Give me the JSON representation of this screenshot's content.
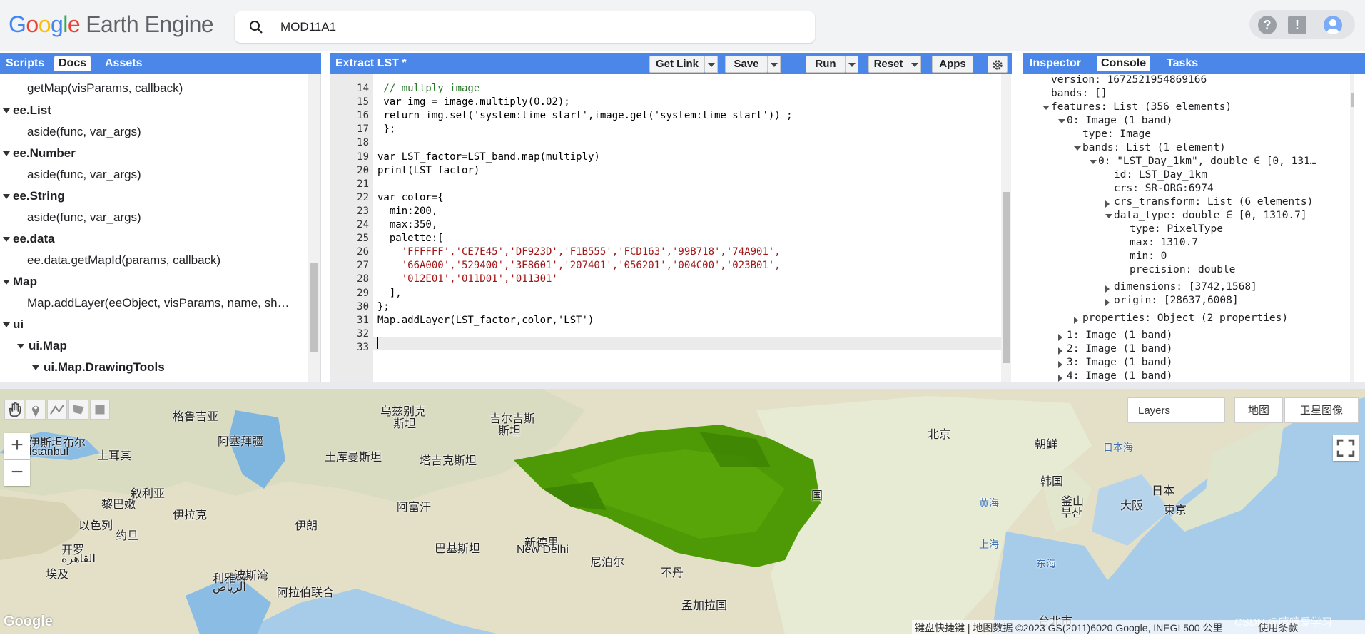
{
  "topbar": {
    "logo_google": [
      "G",
      "o",
      "o",
      "g",
      "l",
      "e"
    ],
    "logo_product": "Earth Engine",
    "search_value": "MOD11A1",
    "help_icon": "help-icon",
    "feedback_icon": "feedback-icon",
    "avatar_icon": "account-avatar-icon"
  },
  "left_panel": {
    "tabs": [
      "Scripts",
      "Docs",
      "Assets"
    ],
    "active_tab": "Docs",
    "items": [
      {
        "text": "getMap(visParams, callback)",
        "bold": false,
        "indent": 1
      },
      {
        "text": "ee.List",
        "bold": true,
        "indent": 0
      },
      {
        "text": "aside(func, var_args)",
        "bold": false,
        "indent": 1
      },
      {
        "text": "ee.Number",
        "bold": true,
        "indent": 0
      },
      {
        "text": "aside(func, var_args)",
        "bold": false,
        "indent": 1
      },
      {
        "text": "ee.String",
        "bold": true,
        "indent": 0
      },
      {
        "text": "aside(func, var_args)",
        "bold": false,
        "indent": 1
      },
      {
        "text": "ee.data",
        "bold": true,
        "indent": 0
      },
      {
        "text": "ee.data.getMapId(params, callback)",
        "bold": false,
        "indent": 1
      },
      {
        "text": "Map",
        "bold": true,
        "indent": 0
      },
      {
        "text": "Map.addLayer(eeObject, visParams, name, sh…",
        "bold": false,
        "indent": 1
      },
      {
        "text": "ui",
        "bold": true,
        "indent": 0
      },
      {
        "text": "ui.Map",
        "bold": true,
        "indent": 1
      },
      {
        "text": "ui.Map.DrawingTools",
        "bold": true,
        "indent": 2
      }
    ]
  },
  "editor": {
    "title": "Extract LST *",
    "buttons": {
      "get_link": "Get Link",
      "save": "Save",
      "run": "Run",
      "reset": "Reset",
      "apps": "Apps"
    },
    "settings_icon": "gear-icon",
    "line_numbers": [
      "14",
      "15",
      "16",
      "17",
      "18",
      "19",
      "20",
      "21",
      "22",
      "23",
      "24",
      "25",
      "26",
      "27",
      "28",
      "29",
      "30",
      "31",
      "32",
      "33"
    ],
    "lines": [
      " // multply image",
      " var img = image.multiply(0.02);",
      " return img.set('system:time_start',image.get('system:time_start')) ;",
      " };",
      "",
      "var LST_factor=LST_band.map(multiply)",
      "print(LST_factor)",
      "",
      "var color={",
      "  min:200,",
      "  max:350,",
      "  palette:[",
      "    'FFFFFF','CE7E45','DF923D','F1B555','FCD163','99B718','74A901',",
      "    '66A000','529400','3E8601','207401','056201','004C00','023B01',",
      "    '012E01','011D01','011301'",
      "  ],",
      "};",
      "Map.addLayer(LST_factor,color,'LST')",
      "",
      ""
    ]
  },
  "right_panel": {
    "tabs": [
      "Inspector",
      "Console",
      "Tasks"
    ],
    "active_tab": "Console",
    "console_lines": [
      {
        "text": "version: 1672521954869166",
        "indent": 0,
        "toggle": "none"
      },
      {
        "text": "bands: []",
        "indent": 0,
        "toggle": "none"
      },
      {
        "text": "features: List (356 elements)",
        "indent": 0,
        "toggle": "open"
      },
      {
        "text": "0: Image (1 band)",
        "indent": 1,
        "toggle": "open"
      },
      {
        "text": "type: Image",
        "indent": 2,
        "toggle": "none"
      },
      {
        "text": "bands: List (1 element)",
        "indent": 2,
        "toggle": "open"
      },
      {
        "text": "0: \"LST_Day_1km\", double ∈ [0, 131…",
        "indent": 3,
        "toggle": "open"
      },
      {
        "text": "id: LST_Day_1km",
        "indent": 4,
        "toggle": "none"
      },
      {
        "text": "crs: SR-ORG:6974",
        "indent": 4,
        "toggle": "none"
      },
      {
        "text": "crs_transform: List (6 elements)",
        "indent": 4,
        "toggle": "closed"
      },
      {
        "text": "data_type: double ∈ [0, 1310.7]",
        "indent": 4,
        "toggle": "open"
      },
      {
        "text": "type: PixelType",
        "indent": 5,
        "toggle": "none"
      },
      {
        "text": "max: 1310.7",
        "indent": 5,
        "toggle": "none"
      },
      {
        "text": "min: 0",
        "indent": 5,
        "toggle": "none"
      },
      {
        "text": "precision: double",
        "indent": 5,
        "toggle": "none"
      },
      {
        "text": "dimensions: [3742,1568]",
        "indent": 4,
        "toggle": "closed"
      },
      {
        "text": "origin: [28637,6008]",
        "indent": 4,
        "toggle": "closed"
      },
      {
        "text": "properties: Object (2 properties)",
        "indent": 2,
        "toggle": "closed"
      },
      {
        "text": "1: Image (1 band)",
        "indent": 1,
        "toggle": "closed"
      },
      {
        "text": "2: Image (1 band)",
        "indent": 1,
        "toggle": "closed"
      },
      {
        "text": "3: Image (1 band)",
        "indent": 1,
        "toggle": "closed"
      },
      {
        "text": "4: Image (1 band)",
        "indent": 1,
        "toggle": "closed"
      }
    ]
  },
  "map": {
    "layers_label": "Layers",
    "map_type": "地图",
    "satellite_type": "卫星图像",
    "zoom_in": "+",
    "zoom_out": "−",
    "fullscreen_icon": "fullscreen-icon",
    "tools": [
      "hand-icon",
      "marker-icon",
      "line-icon",
      "polygon-icon",
      "rectangle-icon"
    ],
    "labels": [
      {
        "text": "格鲁吉亚"
      },
      {
        "text": "阿塞拜疆"
      },
      {
        "text": "土耳其"
      },
      {
        "text": "伊斯坦布尔"
      },
      {
        "text": "İstanbul"
      },
      {
        "text": "叙利亚"
      },
      {
        "text": "黎巴嫩"
      },
      {
        "text": "以色列"
      },
      {
        "text": "约旦"
      },
      {
        "text": "伊拉克"
      },
      {
        "text": "伊朗"
      },
      {
        "text": "开罗"
      },
      {
        "text": "القاهرة"
      },
      {
        "text": "埃及"
      },
      {
        "text": "利雅得"
      },
      {
        "text": "الرياض"
      },
      {
        "text": "阿拉伯联合"
      },
      {
        "text": "波斯湾"
      },
      {
        "text": "乌兹别克"
      },
      {
        "text": "斯坦"
      },
      {
        "text": "吉尔吉斯"
      },
      {
        "text": "斯坦"
      },
      {
        "text": "土库曼斯坦"
      },
      {
        "text": "塔吉克斯坦"
      },
      {
        "text": "阿富汗"
      },
      {
        "text": "巴基斯坦"
      },
      {
        "text": "新德里"
      },
      {
        "text": "New Delhi"
      },
      {
        "text": "尼泊尔"
      },
      {
        "text": "不丹"
      },
      {
        "text": "孟加拉国"
      },
      {
        "text": "国"
      },
      {
        "text": "北京"
      },
      {
        "text": "朝鲜"
      },
      {
        "text": "韩国"
      },
      {
        "text": "釜山"
      },
      {
        "text": "부산"
      },
      {
        "text": "日本海"
      },
      {
        "text": "日本"
      },
      {
        "text": "大阪"
      },
      {
        "text": "東京"
      },
      {
        "text": "黄海"
      },
      {
        "text": "上海"
      },
      {
        "text": "东海"
      },
      {
        "text": "台北市"
      }
    ],
    "attribution": "键盘快捷键 | 地图数据 ©2023 GS(2011)6020 Google, INEGI   500 公里 ———   使用条款",
    "google_watermark": "Google",
    "watermark_overlay": "CSDN @嘻嘻爱学习"
  },
  "colors": {
    "panel_blue": "#4a87e8",
    "layer_green": "#4e9a06"
  }
}
